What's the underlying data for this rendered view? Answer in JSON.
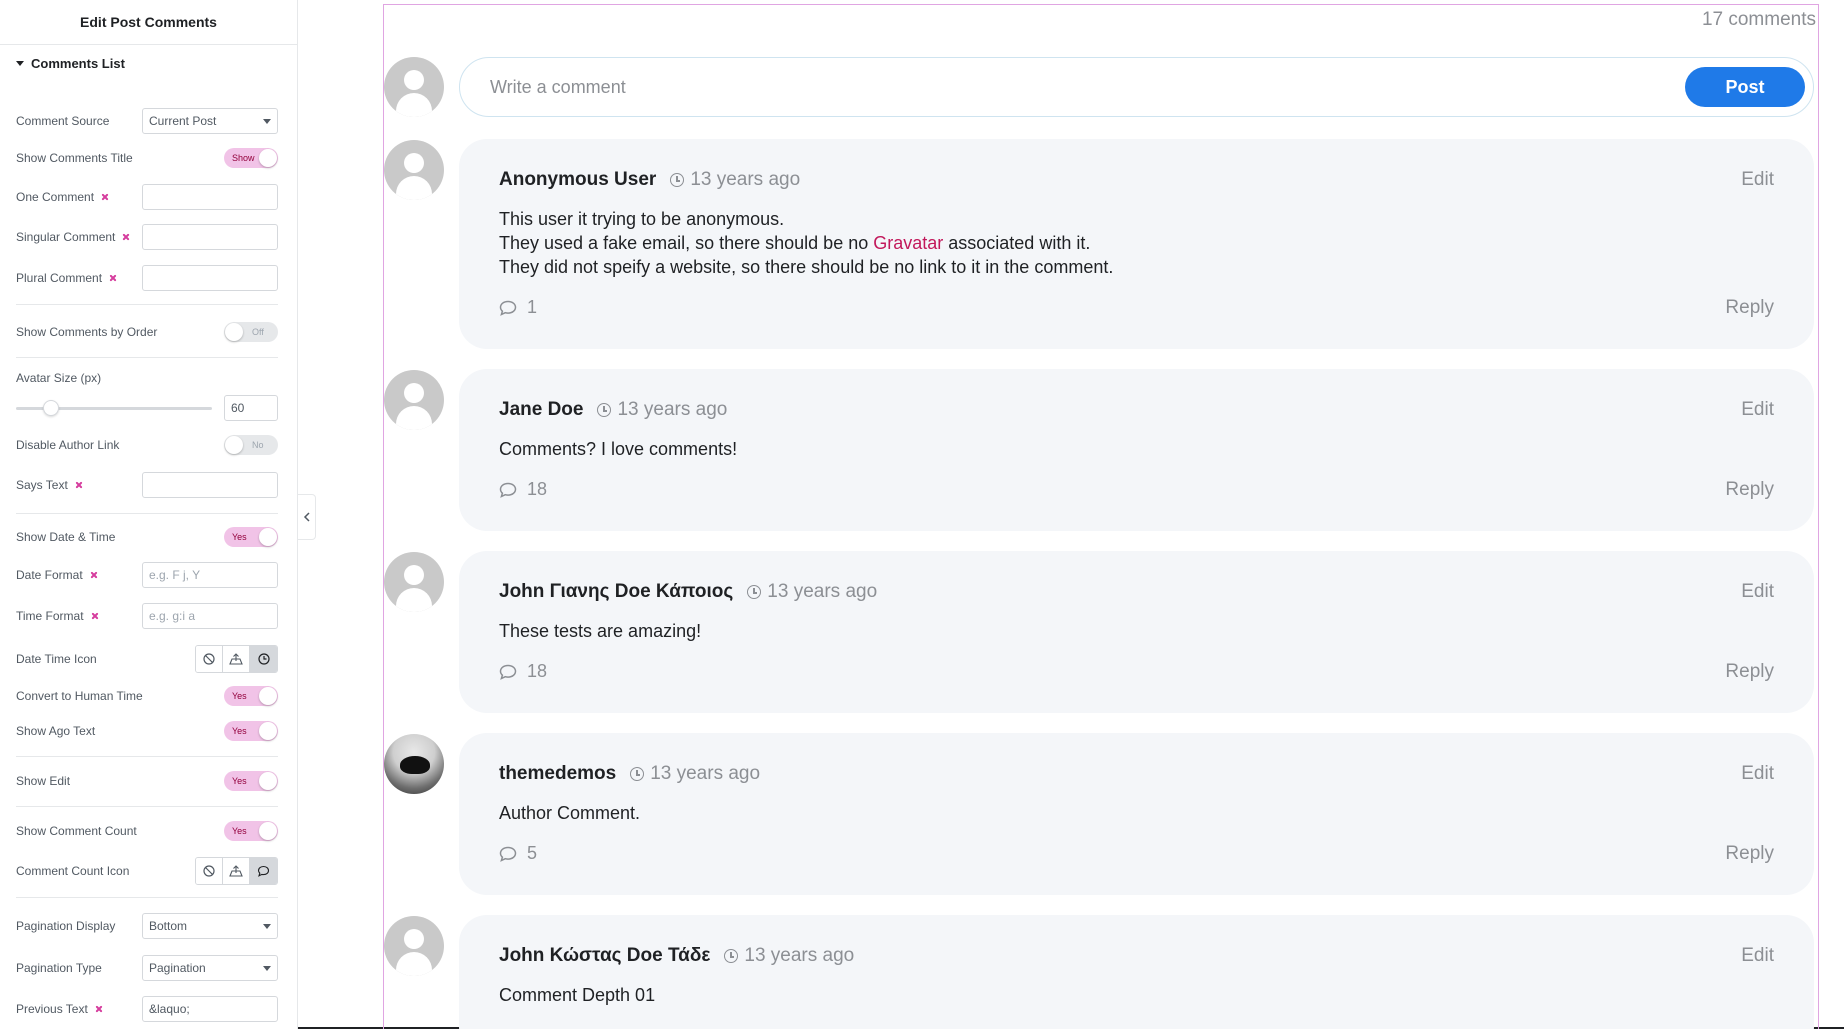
{
  "panel": {
    "title": "Edit Post Comments",
    "section": "Comments List",
    "comment_source": {
      "label": "Comment Source",
      "value": "Current Post"
    },
    "show_comments_title": {
      "label": "Show Comments Title",
      "value": "Show"
    },
    "one_comment": {
      "label": "One Comment",
      "value": ""
    },
    "singular_comment": {
      "label": "Singular Comment",
      "value": ""
    },
    "plural_comment": {
      "label": "Plural Comment",
      "value": ""
    },
    "show_by_order": {
      "label": "Show Comments by Order",
      "value": "Off"
    },
    "avatar_size": {
      "label": "Avatar Size (px)",
      "value": "60",
      "level": 0.15
    },
    "disable_author_link": {
      "label": "Disable Author Link",
      "value": "No"
    },
    "says_text": {
      "label": "Says Text",
      "value": ""
    },
    "show_date_time": {
      "label": "Show Date & Time",
      "value": "Yes"
    },
    "date_format": {
      "label": "Date Format",
      "placeholder": "e.g. F j, Y"
    },
    "time_format": {
      "label": "Time Format",
      "placeholder": "e.g. g:i a"
    },
    "date_time_icon": {
      "label": "Date Time Icon",
      "options": [
        "none-icon",
        "upload-icon",
        "clock-icon"
      ],
      "selected": 2
    },
    "human_time": {
      "label": "Convert to Human Time",
      "value": "Yes"
    },
    "ago_text": {
      "label": "Show Ago Text",
      "value": "Yes"
    },
    "show_edit": {
      "label": "Show Edit",
      "value": "Yes"
    },
    "show_count": {
      "label": "Show Comment Count",
      "value": "Yes"
    },
    "count_icon": {
      "label": "Comment Count Icon",
      "options": [
        "none-icon",
        "upload-icon",
        "comment-icon"
      ],
      "selected": 2
    },
    "pagination_display": {
      "label": "Pagination Display",
      "value": "Bottom"
    },
    "pagination_type": {
      "label": "Pagination Type",
      "value": "Pagination"
    },
    "previous_text": {
      "label": "Previous Text",
      "value": "&laquo;"
    }
  },
  "preview": {
    "total": "17 comments",
    "write_placeholder": "Write a comment",
    "post_label": "Post",
    "edit_label": "Edit",
    "reply_label": "Reply",
    "comments": [
      {
        "author": "Anonymous User",
        "time": "13 years ago",
        "lines": [
          "This user it trying to be anonymous.",
          "They used a fake email, so there should be no ",
          "Gravatar",
          " associated with it.",
          "They did not speify a website, so there should be no link to it in the comment."
        ],
        "count": "1"
      },
      {
        "author": "Jane Doe",
        "time": "13 years ago",
        "text": "Comments? I love comments!",
        "count": "18"
      },
      {
        "author": "John Γιανης Doe Κάποιος",
        "time": "13 years ago",
        "text": "These tests are amazing!",
        "count": "18"
      },
      {
        "author": "themedemos",
        "time": "13 years ago",
        "text": "Author Comment.",
        "count": "5"
      },
      {
        "author": "John Κώστας Doe Τάδε",
        "time": "13 years ago",
        "text": "Comment Depth 01"
      }
    ]
  },
  "colors": {
    "accent": "#d63e9e",
    "post_button": "#1f7ae8",
    "frame": "#e0a5e2",
    "link": "#c2185b"
  }
}
